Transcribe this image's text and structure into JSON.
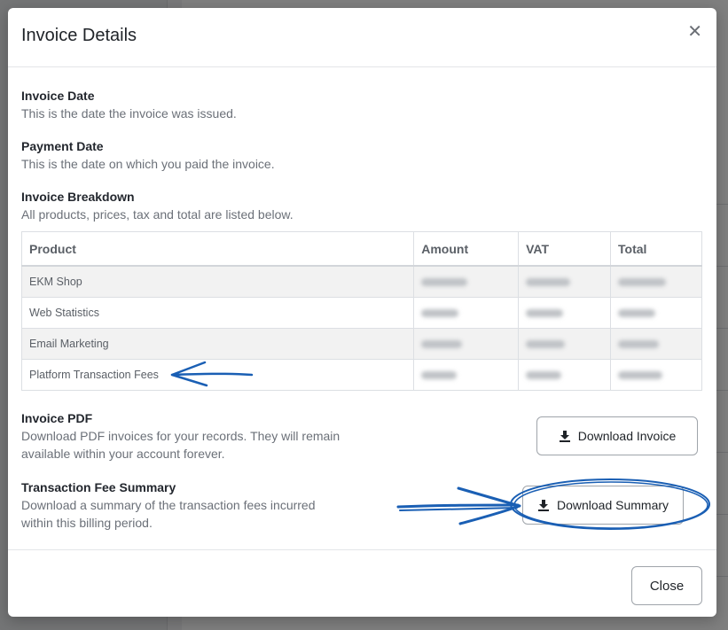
{
  "modal": {
    "title": "Invoice Details",
    "close_icon": "close-icon",
    "invoice_date": {
      "label": "Invoice Date",
      "desc": "This is the date the invoice was issued."
    },
    "payment_date": {
      "label": "Payment Date",
      "desc": "This is the date on which you paid the invoice."
    },
    "breakdown": {
      "label": "Invoice Breakdown",
      "desc": "All products, prices, tax and total are listed below.",
      "columns": [
        "Product",
        "Amount",
        "VAT",
        "Total"
      ],
      "rows": [
        {
          "product": "EKM Shop"
        },
        {
          "product": "Web Statistics"
        },
        {
          "product": "Email Marketing"
        },
        {
          "product": "Platform Transaction Fees"
        }
      ]
    },
    "invoice_pdf": {
      "label": "Invoice PDF",
      "desc_line1": "Download PDF invoices for your records. They will remain",
      "desc_line2": "available within your account forever.",
      "button_label": "Download Invoice",
      "button_icon": "download-icon"
    },
    "fee_summary": {
      "label": "Transaction Fee Summary",
      "desc_line1": "Download a summary of the transaction fees incurred",
      "desc_line2": "within this billing period.",
      "button_label": "Download Summary",
      "button_icon": "download-icon"
    },
    "close_button_label": "Close"
  },
  "annotations": {
    "color": "#1a5fb4"
  }
}
